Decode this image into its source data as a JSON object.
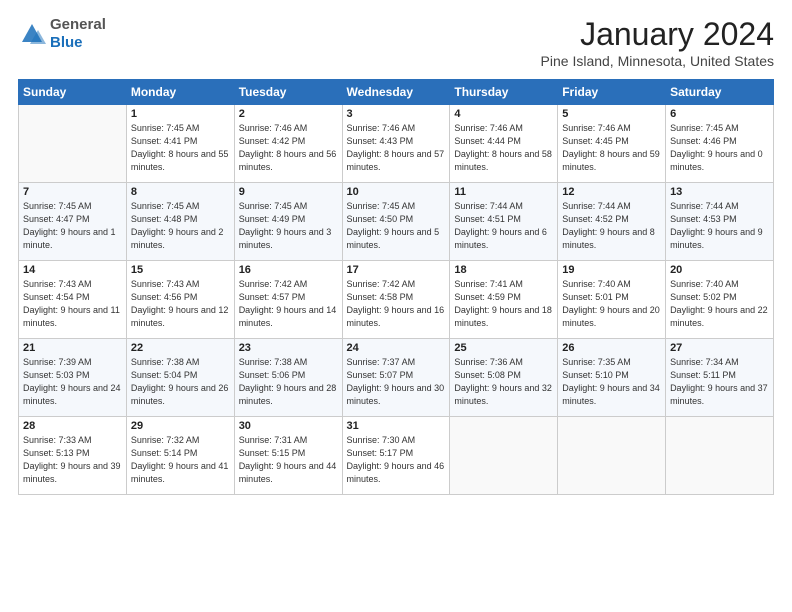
{
  "header": {
    "logo_line1": "General",
    "logo_line2": "Blue",
    "month_title": "January 2024",
    "location": "Pine Island, Minnesota, United States"
  },
  "weekdays": [
    "Sunday",
    "Monday",
    "Tuesday",
    "Wednesday",
    "Thursday",
    "Friday",
    "Saturday"
  ],
  "weeks": [
    [
      {
        "day": "",
        "info": ""
      },
      {
        "day": "1",
        "info": "Sunrise: 7:45 AM\nSunset: 4:41 PM\nDaylight: 8 hours\nand 55 minutes."
      },
      {
        "day": "2",
        "info": "Sunrise: 7:46 AM\nSunset: 4:42 PM\nDaylight: 8 hours\nand 56 minutes."
      },
      {
        "day": "3",
        "info": "Sunrise: 7:46 AM\nSunset: 4:43 PM\nDaylight: 8 hours\nand 57 minutes."
      },
      {
        "day": "4",
        "info": "Sunrise: 7:46 AM\nSunset: 4:44 PM\nDaylight: 8 hours\nand 58 minutes."
      },
      {
        "day": "5",
        "info": "Sunrise: 7:46 AM\nSunset: 4:45 PM\nDaylight: 8 hours\nand 59 minutes."
      },
      {
        "day": "6",
        "info": "Sunrise: 7:45 AM\nSunset: 4:46 PM\nDaylight: 9 hours\nand 0 minutes."
      }
    ],
    [
      {
        "day": "7",
        "info": "Sunrise: 7:45 AM\nSunset: 4:47 PM\nDaylight: 9 hours\nand 1 minute."
      },
      {
        "day": "8",
        "info": "Sunrise: 7:45 AM\nSunset: 4:48 PM\nDaylight: 9 hours\nand 2 minutes."
      },
      {
        "day": "9",
        "info": "Sunrise: 7:45 AM\nSunset: 4:49 PM\nDaylight: 9 hours\nand 3 minutes."
      },
      {
        "day": "10",
        "info": "Sunrise: 7:45 AM\nSunset: 4:50 PM\nDaylight: 9 hours\nand 5 minutes."
      },
      {
        "day": "11",
        "info": "Sunrise: 7:44 AM\nSunset: 4:51 PM\nDaylight: 9 hours\nand 6 minutes."
      },
      {
        "day": "12",
        "info": "Sunrise: 7:44 AM\nSunset: 4:52 PM\nDaylight: 9 hours\nand 8 minutes."
      },
      {
        "day": "13",
        "info": "Sunrise: 7:44 AM\nSunset: 4:53 PM\nDaylight: 9 hours\nand 9 minutes."
      }
    ],
    [
      {
        "day": "14",
        "info": "Sunrise: 7:43 AM\nSunset: 4:54 PM\nDaylight: 9 hours\nand 11 minutes."
      },
      {
        "day": "15",
        "info": "Sunrise: 7:43 AM\nSunset: 4:56 PM\nDaylight: 9 hours\nand 12 minutes."
      },
      {
        "day": "16",
        "info": "Sunrise: 7:42 AM\nSunset: 4:57 PM\nDaylight: 9 hours\nand 14 minutes."
      },
      {
        "day": "17",
        "info": "Sunrise: 7:42 AM\nSunset: 4:58 PM\nDaylight: 9 hours\nand 16 minutes."
      },
      {
        "day": "18",
        "info": "Sunrise: 7:41 AM\nSunset: 4:59 PM\nDaylight: 9 hours\nand 18 minutes."
      },
      {
        "day": "19",
        "info": "Sunrise: 7:40 AM\nSunset: 5:01 PM\nDaylight: 9 hours\nand 20 minutes."
      },
      {
        "day": "20",
        "info": "Sunrise: 7:40 AM\nSunset: 5:02 PM\nDaylight: 9 hours\nand 22 minutes."
      }
    ],
    [
      {
        "day": "21",
        "info": "Sunrise: 7:39 AM\nSunset: 5:03 PM\nDaylight: 9 hours\nand 24 minutes."
      },
      {
        "day": "22",
        "info": "Sunrise: 7:38 AM\nSunset: 5:04 PM\nDaylight: 9 hours\nand 26 minutes."
      },
      {
        "day": "23",
        "info": "Sunrise: 7:38 AM\nSunset: 5:06 PM\nDaylight: 9 hours\nand 28 minutes."
      },
      {
        "day": "24",
        "info": "Sunrise: 7:37 AM\nSunset: 5:07 PM\nDaylight: 9 hours\nand 30 minutes."
      },
      {
        "day": "25",
        "info": "Sunrise: 7:36 AM\nSunset: 5:08 PM\nDaylight: 9 hours\nand 32 minutes."
      },
      {
        "day": "26",
        "info": "Sunrise: 7:35 AM\nSunset: 5:10 PM\nDaylight: 9 hours\nand 34 minutes."
      },
      {
        "day": "27",
        "info": "Sunrise: 7:34 AM\nSunset: 5:11 PM\nDaylight: 9 hours\nand 37 minutes."
      }
    ],
    [
      {
        "day": "28",
        "info": "Sunrise: 7:33 AM\nSunset: 5:13 PM\nDaylight: 9 hours\nand 39 minutes."
      },
      {
        "day": "29",
        "info": "Sunrise: 7:32 AM\nSunset: 5:14 PM\nDaylight: 9 hours\nand 41 minutes."
      },
      {
        "day": "30",
        "info": "Sunrise: 7:31 AM\nSunset: 5:15 PM\nDaylight: 9 hours\nand 44 minutes."
      },
      {
        "day": "31",
        "info": "Sunrise: 7:30 AM\nSunset: 5:17 PM\nDaylight: 9 hours\nand 46 minutes."
      },
      {
        "day": "",
        "info": ""
      },
      {
        "day": "",
        "info": ""
      },
      {
        "day": "",
        "info": ""
      }
    ]
  ]
}
